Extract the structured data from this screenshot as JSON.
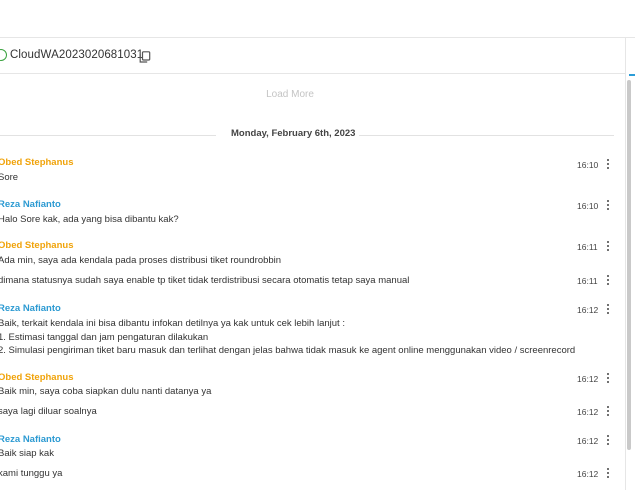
{
  "header": {
    "title": "CloudWA2023020681031",
    "icons": {
      "status": "status-circle-icon",
      "copy": "copy-icon"
    },
    "colors": {
      "status": "#3aa23f",
      "accent": "#2c9dd8"
    }
  },
  "chat": {
    "load_more": "Load More",
    "date_separator": "Monday, February 6th, 2023",
    "colors": {
      "agent_name": "#f0a30a",
      "support_name": "#2c9ad2"
    },
    "messages": [
      {
        "sender": "Obed Stephanus",
        "lines": [
          "Sore"
        ],
        "time": "16:10"
      },
      {
        "sender": "Reza Nafianto",
        "lines": [
          "Halo Sore kak, ada yang bisa dibantu kak?"
        ],
        "time": "16:10"
      },
      {
        "sender": "Obed Stephanus",
        "lines": [
          "Ada min, saya ada kendala pada proses distribusi tiket roundrobbin"
        ],
        "time": "16:11"
      },
      {
        "sender": "",
        "lines": [
          "dimana statusnya sudah saya enable tp tiket tidak terdistribusi secara otomatis tetap saya manual"
        ],
        "time": "16:11"
      },
      {
        "sender": "Reza Nafianto",
        "lines": [
          "Baik, terkait kendala ini bisa dibantu infokan detilnya ya kak untuk cek lebih lanjut :",
          "1. Estimasi tanggal dan jam pengaturan dilakukan",
          "2. Simulasi pengiriman tiket baru masuk dan terlihat dengan jelas bahwa tidak masuk ke agent online menggunakan video / screenrecord"
        ],
        "time": "16:12"
      },
      {
        "sender": "Obed Stephanus",
        "lines": [
          "Baik min, saya coba siapkan dulu nanti datanya ya"
        ],
        "time": "16:12"
      },
      {
        "sender": "",
        "lines": [
          "saya lagi diluar soalnya"
        ],
        "time": "16:12"
      },
      {
        "sender": "Reza Nafianto",
        "lines": [
          "Baik siap kak"
        ],
        "time": "16:12"
      },
      {
        "sender": "",
        "lines": [
          "kami tunggu ya"
        ],
        "time": "16:12"
      }
    ]
  }
}
